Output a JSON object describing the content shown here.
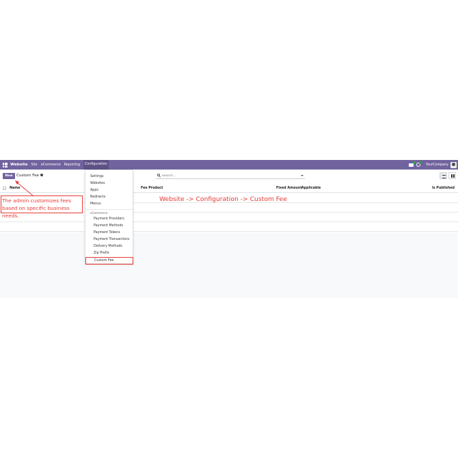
{
  "navbar": {
    "brand": "Website",
    "menus": [
      "Site",
      "eCommerce",
      "Reporting",
      "Configuration"
    ],
    "company": "YourCompany"
  },
  "control": {
    "new_label": "New",
    "breadcrumb": "Custom Fee",
    "search_placeholder": "Search..."
  },
  "table": {
    "columns": [
      "Name",
      "Fee Product",
      "Fixed Amount",
      "Applicable",
      "Is Published"
    ]
  },
  "dropdown": {
    "items": [
      "Settings",
      "Websites",
      "Apps",
      "Redirects",
      "Menus"
    ],
    "section_header": "eCommerce",
    "sub_items": [
      "Payment Providers",
      "Payment Methods",
      "Payment Tokens",
      "Payment Transactions",
      "Delivery Methods",
      "Zip Prefix",
      "Custom Fee"
    ]
  },
  "annotations": {
    "note": "The admin customizes fees based on specific business needs.",
    "path": "Website -> Configuration -> Custom Fee"
  },
  "colors": {
    "navbar": "#71639e",
    "annotation": "#e53935"
  }
}
